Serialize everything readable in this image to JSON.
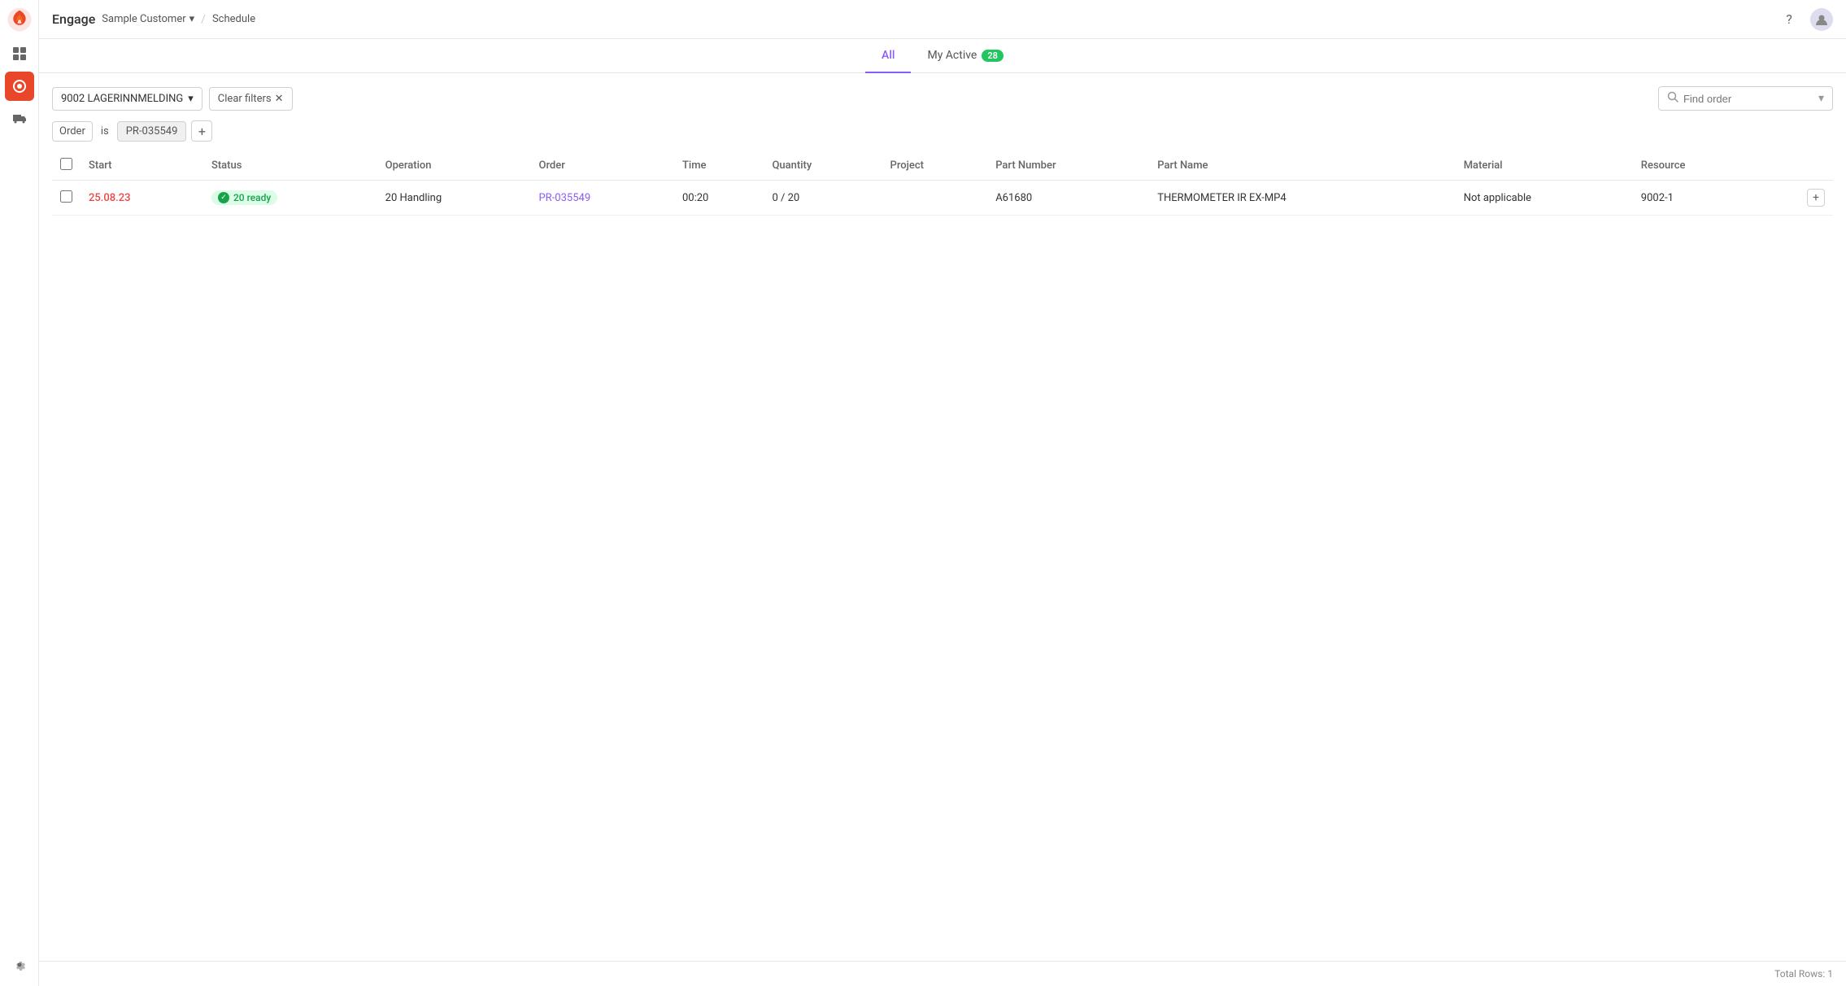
{
  "app": {
    "name": "Engage",
    "customer": "Sample Customer",
    "breadcrumb": "Schedule"
  },
  "tabs": {
    "all_label": "All",
    "my_active_label": "My Active",
    "my_active_count": "28",
    "active_tab": "all"
  },
  "filters": {
    "dropdown_value": "9002 LAGERINNMELDING",
    "clear_filters_label": "Clear filters",
    "search_placeholder": "Find order",
    "order_label": "Order",
    "order_condition": "is",
    "order_value": "PR-035549"
  },
  "table": {
    "columns": [
      "Start",
      "Status",
      "Operation",
      "Order",
      "Time",
      "Quantity",
      "Project",
      "Part Number",
      "Part Name",
      "Material",
      "Resource"
    ],
    "rows": [
      {
        "start": "25.08.23",
        "status": "20 ready",
        "operation": "20 Handling",
        "order": "PR-035549",
        "time": "00:20",
        "quantity": "0 / 20",
        "project": "",
        "part_number": "A61680",
        "part_name": "THERMOMETER IR EX-MP4",
        "material": "Not applicable",
        "resource": "9002-1"
      }
    ]
  },
  "footer": {
    "total_rows_label": "Total Rows: 1"
  },
  "sidebar": {
    "icons": [
      "grid",
      "settings-active",
      "truck"
    ],
    "bottom_icons": [
      "gear"
    ]
  },
  "colors": {
    "accent_purple": "#8b5cf6",
    "accent_red": "#e44",
    "green": "#16a34a",
    "badge_bg": "#dcfce7"
  }
}
